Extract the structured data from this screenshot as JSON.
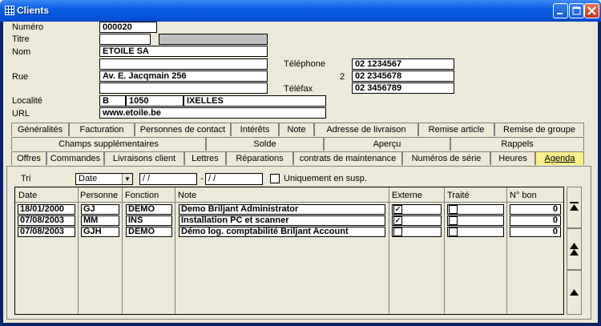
{
  "window": {
    "title": "Clients"
  },
  "form": {
    "numero_label": "Numéro",
    "numero": "000020",
    "titre_label": "Titre",
    "titre": "",
    "titre2": "",
    "nom_label": "Nom",
    "nom": "ETOILE SA",
    "nom2": "",
    "rue_label": "Rue",
    "rue": "Av. E. Jacqmain 256",
    "rue2": "",
    "localite_label": "Localité",
    "pays": "B",
    "cp": "1050",
    "ville": "IXELLES",
    "url_label": "URL",
    "url": "www.etoile.be",
    "telephone_label": "Téléphone",
    "tel1": "02 1234567",
    "tel2_prefix": "2",
    "tel2": "02 2345678",
    "telefax_label": "Téléfax",
    "fax": "02 3456789"
  },
  "tabs_row1": [
    "Généralités",
    "Facturation",
    "Personnes de contact",
    "Intérêts",
    "Note",
    "Adresse de livraison",
    "Remise article",
    "Remise de groupe"
  ],
  "tabs_row2": [
    "Champs supplémentaires",
    "Solde",
    "Aperçu",
    "Rappels"
  ],
  "tabs_row3": [
    "Offres",
    "Commandes",
    "Livraisons client",
    "Lettres",
    "Réparations",
    "contrats de maintenance",
    "Numéros de série",
    "Heures",
    "Agenda"
  ],
  "agenda": {
    "tri_label": "Tri",
    "tri_value": "Date",
    "date_from": "  /  /",
    "date_sep": "-",
    "date_to": "  /  /",
    "susp_label": "Uniquement en susp.",
    "columns": [
      "Date",
      "Personne",
      "Fonction",
      "Note",
      "Externe",
      "Traité",
      "N° bon"
    ],
    "rows": [
      {
        "date": "18/01/2000",
        "personne": "GJ",
        "fonction": "DEMO",
        "note": "Demo Briljant Administrator",
        "externe": true,
        "traite": false,
        "bon": "0"
      },
      {
        "date": "07/08/2003",
        "personne": "MM",
        "fonction": "INS",
        "note": "Installation PC et scanner",
        "externe": true,
        "traite": false,
        "bon": "0"
      },
      {
        "date": "07/08/2003",
        "personne": "GJH",
        "fonction": "DEMO",
        "note": "Démo log. comptabilité Briljant Account",
        "externe": false,
        "traite": false,
        "bon": "0"
      }
    ]
  },
  "colors": {
    "active_tab": "#f7ef8a",
    "titlebar": "#0a5ce6"
  }
}
